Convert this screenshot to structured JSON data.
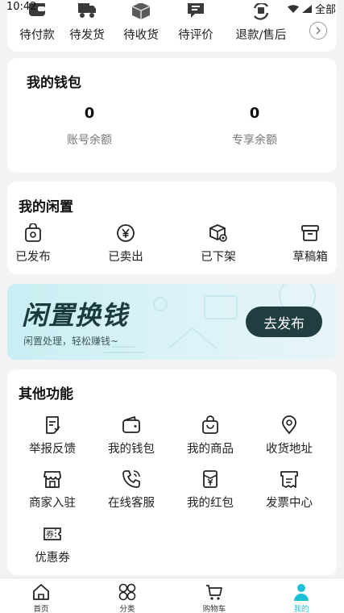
{
  "status_bar": {
    "time": "10:42",
    "right_text": "全部"
  },
  "orders": {
    "items": [
      {
        "label": "待付款",
        "icon": "wallet-icon"
      },
      {
        "label": "待发货",
        "icon": "truck-icon"
      },
      {
        "label": "待收货",
        "icon": "package-icon"
      },
      {
        "label": "待评价",
        "icon": "comment-icon"
      },
      {
        "label": "退款/售后",
        "icon": "refund-icon"
      }
    ],
    "more_icon": "chevron-right-icon"
  },
  "wallet": {
    "title": "我的钱包",
    "account_balance": {
      "value": "0",
      "label": "账号余额"
    },
    "exclusive_balance": {
      "value": "0",
      "label": "专享余额"
    }
  },
  "idle": {
    "title": "我的闲置",
    "items": [
      {
        "label": "已发布",
        "icon": "bag-icon"
      },
      {
        "label": "已卖出",
        "icon": "yuan-coin-icon"
      },
      {
        "label": "已下架",
        "icon": "box-off-icon"
      },
      {
        "label": "草稿箱",
        "icon": "archive-icon"
      }
    ]
  },
  "banner": {
    "title": "闲置换钱",
    "subtitle": "闲置处理，轻松赚钱~",
    "button": "去发布"
  },
  "other": {
    "title": "其他功能",
    "items": [
      {
        "label": "举报反馈",
        "icon": "report-icon"
      },
      {
        "label": "我的钱包",
        "icon": "wallet-icon"
      },
      {
        "label": "我的商品",
        "icon": "shopping-bag-icon"
      },
      {
        "label": "收货地址",
        "icon": "location-pin-icon"
      },
      {
        "label": "商家入驻",
        "icon": "store-icon"
      },
      {
        "label": "在线客服",
        "icon": "phone-icon"
      },
      {
        "label": "我的红包",
        "icon": "red-envelope-icon"
      },
      {
        "label": "发票中心",
        "icon": "invoice-icon"
      },
      {
        "label": "优惠券",
        "icon": "coupon-icon"
      }
    ]
  },
  "tabbar": {
    "items": [
      {
        "label": "首页",
        "icon": "home-icon"
      },
      {
        "label": "分类",
        "icon": "category-icon"
      },
      {
        "label": "购物车",
        "icon": "cart-icon"
      },
      {
        "label": "我的",
        "icon": "user-icon"
      }
    ],
    "active_index": 3,
    "active_color": "#1ec0d6"
  }
}
